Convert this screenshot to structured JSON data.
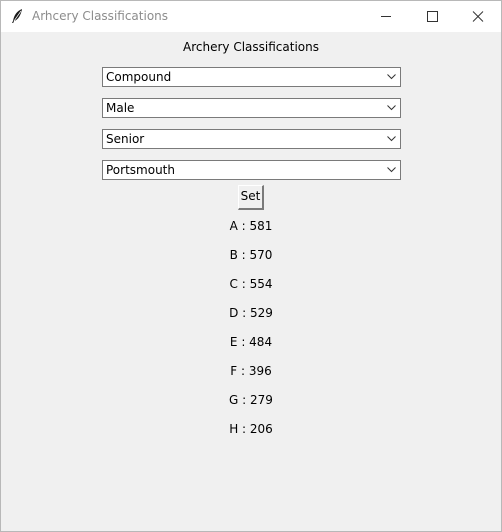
{
  "window": {
    "title": "Arhcery Classifications",
    "icons": {
      "app": "feather-icon",
      "minimize": "minimize-icon",
      "maximize": "maximize-icon",
      "close": "close-icon"
    }
  },
  "form": {
    "heading": "Archery Classifications",
    "selects": {
      "bow_type": "Compound",
      "gender": "Male",
      "age_group": "Senior",
      "round": "Portsmouth"
    },
    "set_label": "Set"
  },
  "results": [
    {
      "grade": "A",
      "sep": " : ",
      "score": "581"
    },
    {
      "grade": "B",
      "sep": " : ",
      "score": "570"
    },
    {
      "grade": "C",
      "sep": " : ",
      "score": "554"
    },
    {
      "grade": "D",
      "sep": " : ",
      "score": "529"
    },
    {
      "grade": "E",
      "sep": " : ",
      "score": "484"
    },
    {
      "grade": "F",
      "sep": " : ",
      "score": "396"
    },
    {
      "grade": "G",
      "sep": " : ",
      "score": "279"
    },
    {
      "grade": "H",
      "sep": " : ",
      "score": "206"
    }
  ]
}
